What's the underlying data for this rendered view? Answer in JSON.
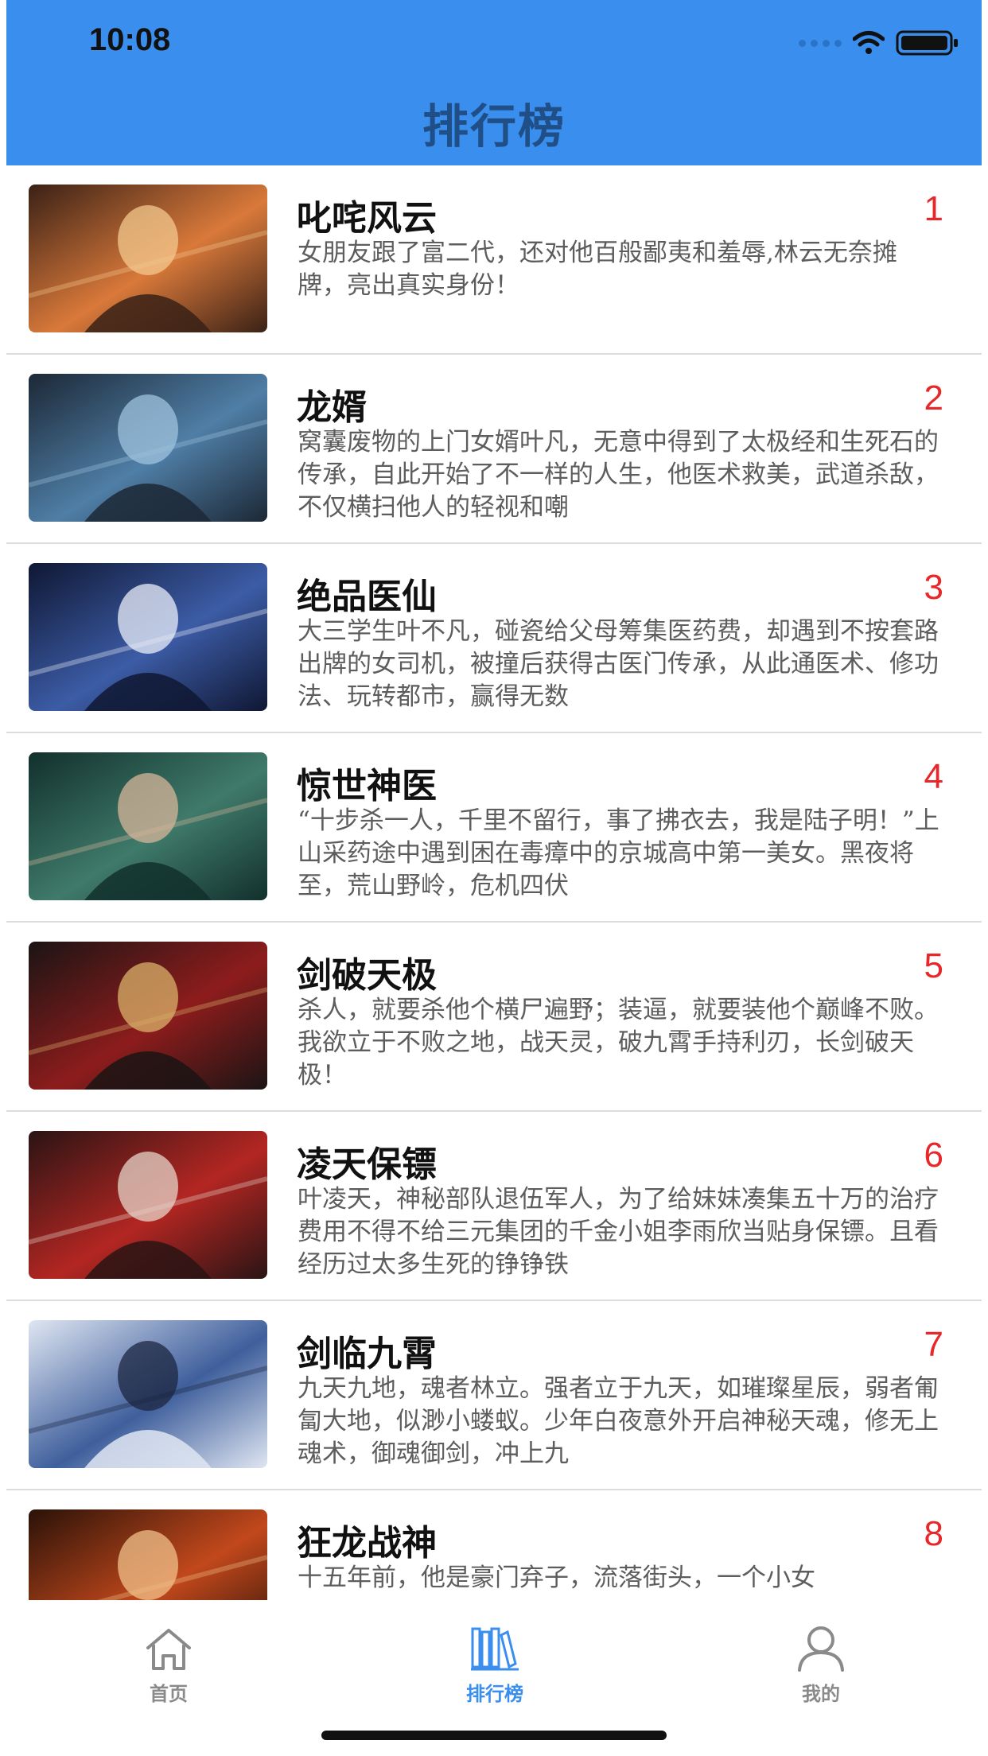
{
  "status_bar": {
    "time": "10:08"
  },
  "header": {
    "title": "排行榜"
  },
  "books": [
    {
      "title": "叱咤风云",
      "rank": "1",
      "desc": "女朋友跟了富二代，还对他百般鄙夷和羞辱,林云无奈摊牌，亮出真实身份！",
      "cover_colors": [
        "#3a2116",
        "#d9793a",
        "#f3c88e"
      ]
    },
    {
      "title": "龙婿",
      "rank": "2",
      "desc": "窝囊废物的上门女婿叶凡，无意中得到了太极经和生死石的传承，自此开始了不一样的人生，他医术救美，武道杀敌，不仅横扫他人的轻视和嘲",
      "cover_colors": [
        "#1c2836",
        "#4f7ea6",
        "#9fc3dd"
      ]
    },
    {
      "title": "绝品医仙",
      "rank": "3",
      "desc": "大三学生叶不凡，碰瓷给父母筹集医药费，却遇到不按套路出牌的女司机，被撞后获得古医门传承，从此通医术、修功法、玩转都市，赢得无数",
      "cover_colors": [
        "#0f1733",
        "#3c5ca6",
        "#e9eef8"
      ]
    },
    {
      "title": "惊世神医",
      "rank": "4",
      "desc": "“十步杀一人，千里不留行，事了拂衣去，我是陆子明！”上山采药途中遇到困在毒瘴中的京城高中第一美女。黑夜将至，荒山野岭，危机四伏",
      "cover_colors": [
        "#12302c",
        "#3f7a6a",
        "#d7b59a"
      ]
    },
    {
      "title": "剑破天极",
      "rank": "5",
      "desc": "杀人，就要杀他个横尸遍野；装逼，就要装他个巅峰不败。我欲立于不败之地，战天灵，破九霄手持利刃，长剑破天极！",
      "cover_colors": [
        "#1b1414",
        "#8d1c1c",
        "#d9b26a"
      ]
    },
    {
      "title": "凌天保镖",
      "rank": "6",
      "desc": "叶凌天，神秘部队退伍军人，为了给妹妹凑集五十万的治疗费用不得不给三元集团的千金小姐李雨欣当贴身保镖。且看经历过太多生死的铮铮铁",
      "cover_colors": [
        "#2a1414",
        "#b32622",
        "#e6d4c8"
      ]
    },
    {
      "title": "剑临九霄",
      "rank": "7",
      "desc": "九天九地，魂者林立。强者立于九天，如璀璨星辰，弱者匍匐大地，似渺小蝼蚁。少年白夜意外开启神秘天魂，修无上魂术，御魂御剑，冲上九",
      "cover_colors": [
        "#dfe6f2",
        "#3f5f9c",
        "#1c2540"
      ]
    },
    {
      "title": "狂龙战神",
      "rank": "8",
      "desc": "十五年前，他是豪门弃子，流落街头，一个小女",
      "cover_colors": [
        "#2a1208",
        "#c2481c",
        "#f0c089"
      ]
    }
  ],
  "tabbar": {
    "tabs": [
      {
        "label": "首页",
        "icon": "home-icon",
        "active": false
      },
      {
        "label": "排行榜",
        "icon": "bookshelf-icon",
        "active": true
      },
      {
        "label": "我的",
        "icon": "user-icon",
        "active": false
      }
    ],
    "active_color": "#3a8eee",
    "inactive_color": "#8a8a8a"
  },
  "colors": {
    "header_bg": "#3a8eee",
    "rank_color": "#e8272b"
  }
}
